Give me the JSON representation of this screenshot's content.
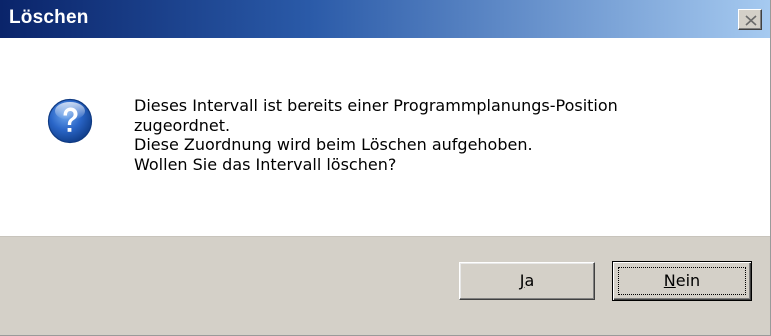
{
  "window": {
    "title": "Löschen"
  },
  "icons": {
    "close": "close-icon",
    "question": "question-icon"
  },
  "message": {
    "line1": "Dieses Intervall ist bereits einer Programmplanungs-Position",
    "line2": "zugeordnet.",
    "line3": "Diese Zuordnung wird beim Löschen aufgehoben.",
    "line4": "Wollen Sie das Intervall löschen?"
  },
  "buttons": {
    "yes_mnemonic": "J",
    "yes_rest": "a",
    "no_mnemonic": "N",
    "no_rest": "ein"
  },
  "colors": {
    "titlebar_start": "#0a246a",
    "titlebar_end": "#a6caf0",
    "face": "#d4d0c8",
    "icon_blue": "#1f5fbf"
  }
}
